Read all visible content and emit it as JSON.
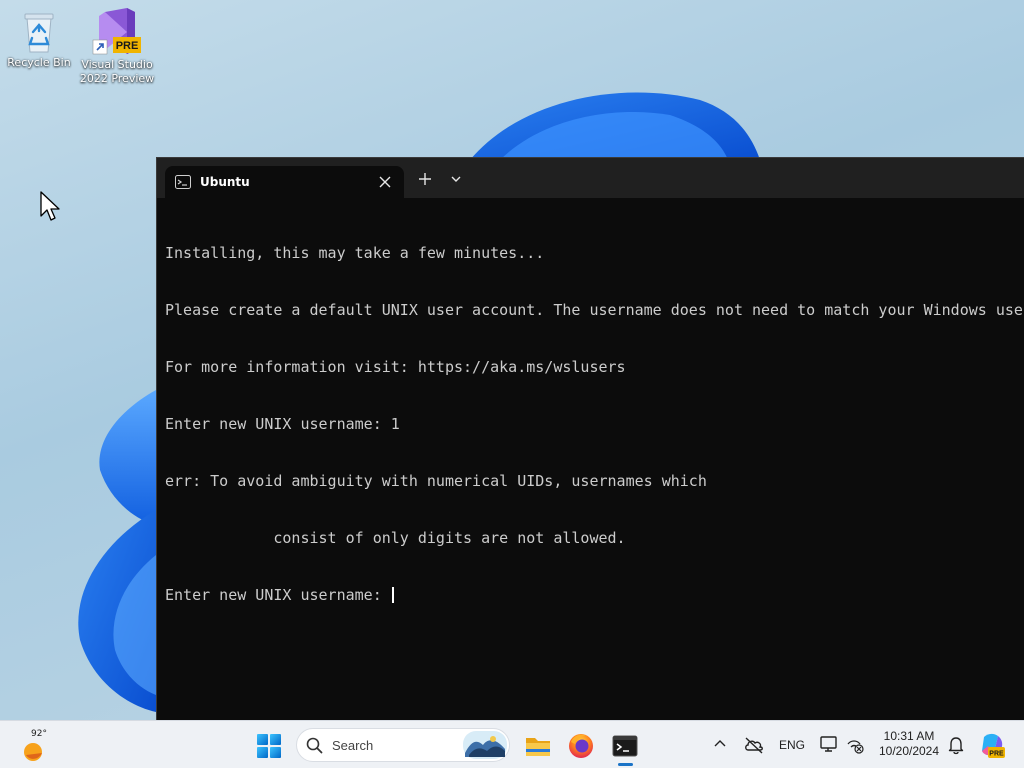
{
  "desktop": {
    "icons": [
      {
        "label_line1": "Recycle Bin",
        "label_line2": "",
        "icon": "recycle-bin-icon"
      },
      {
        "label_line1": "Visual Studio",
        "label_line2": "2022 Preview",
        "icon": "visual-studio-icon",
        "badge": "PRE"
      }
    ]
  },
  "terminal": {
    "tab": {
      "title": "Ubuntu",
      "icon": "terminal-tab-icon"
    },
    "lines": [
      "Installing, this may take a few minutes...",
      "Please create a default UNIX user account. The username does not need to match your Windows username.",
      "For more information visit: https://aka.ms/wslusers",
      "Enter new UNIX username: 1",
      "err: To avoid ambiguity with numerical UIDs, usernames which",
      "            consist of only digits are not allowed.",
      "Enter new UNIX username: "
    ],
    "colors": {
      "background": "#0c0c0c",
      "foreground": "#cccccc",
      "tabstrip": "#202020"
    }
  },
  "taskbar": {
    "weather": {
      "temp": "92°",
      "icon": "weather-sun-icon"
    },
    "search": {
      "label": "Search"
    },
    "apps": [
      "file-explorer-icon",
      "firefox-icon",
      "terminal-icon"
    ],
    "active_app": "terminal",
    "language": "ENG",
    "clock": {
      "time": "10:31 AM",
      "date": "10/20/2024"
    },
    "accent": "#1a73c7"
  }
}
